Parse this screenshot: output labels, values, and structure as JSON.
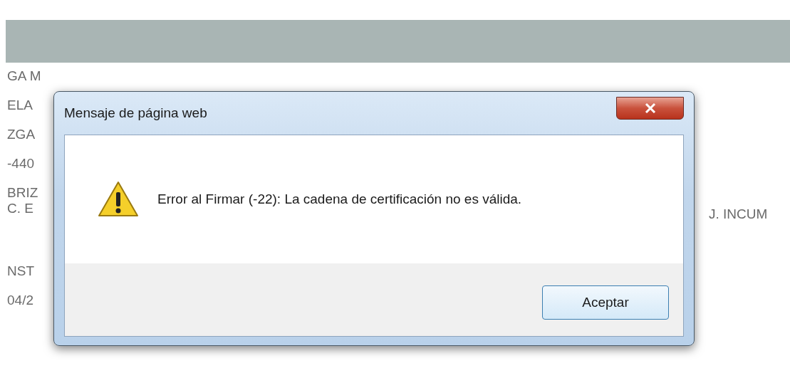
{
  "page": {
    "left_lines": [
      "GA M",
      "ELA",
      "ZGA",
      "-440",
      "BRIZ",
      "C. E",
      "NST",
      "04/2"
    ],
    "right_text": "J. INCUM"
  },
  "dialog": {
    "title": "Mensaje de página web",
    "message": "Error al Firmar (-22): La cadena de certificación no es válida.",
    "buttons": [
      "Aceptar"
    ]
  }
}
